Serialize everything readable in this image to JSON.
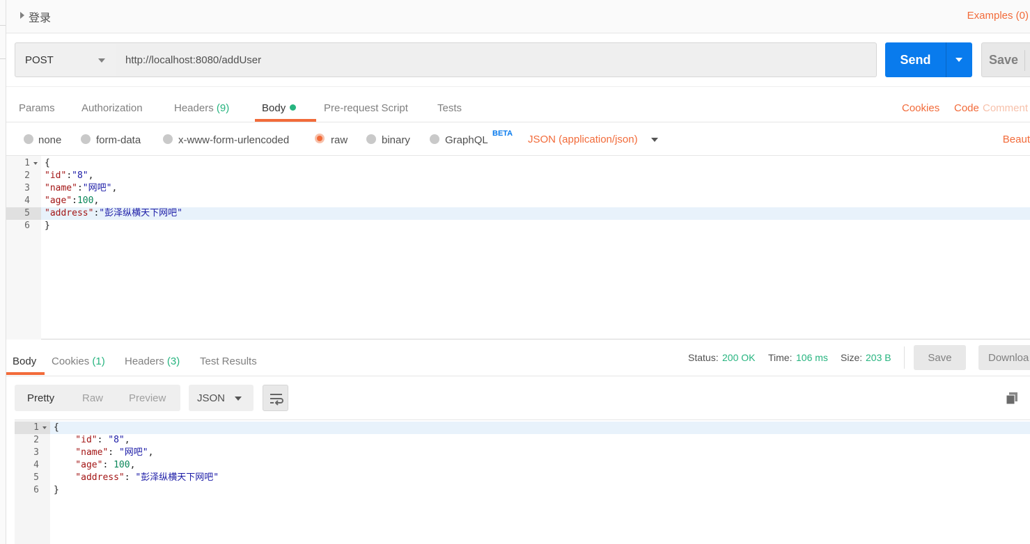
{
  "header": {
    "title": "登录",
    "examples_label": "Examples (0)"
  },
  "request": {
    "method": "POST",
    "url": "http://localhost:8080/addUser",
    "send_label": "Send",
    "save_label": "Save"
  },
  "request_tabs": {
    "params": "Params",
    "authorization": "Authorization",
    "headers": "Headers",
    "headers_count": "(9)",
    "body": "Body",
    "pre_request": "Pre-request Script",
    "tests": "Tests",
    "cookies": "Cookies",
    "code": "Code",
    "comments": "Comment"
  },
  "body_options": {
    "none": "none",
    "form_data": "form-data",
    "urlencoded": "x-www-form-urlencoded",
    "raw": "raw",
    "binary": "binary",
    "graphql": "GraphQL",
    "beta": "BETA",
    "content_type": "JSON (application/json)",
    "beautify": "Beaut",
    "selected": "raw"
  },
  "request_body": {
    "lines": [
      {
        "n": "1",
        "text": "{"
      },
      {
        "n": "2",
        "key": "\"id\"",
        "sep": ":",
        "val": "\"8\"",
        "end": ","
      },
      {
        "n": "3",
        "key": "\"name\"",
        "sep": ":",
        "val": "\"网吧\"",
        "end": ","
      },
      {
        "n": "4",
        "key": "\"age\"",
        "sep": ":",
        "val": "100",
        "end": ","
      },
      {
        "n": "5",
        "key": "\"address\"",
        "sep": ":",
        "val": "\"彭泽纵横天下网吧\"",
        "end": ""
      },
      {
        "n": "6",
        "text": "}"
      }
    ],
    "highlighted_line": 5
  },
  "response_tabs": {
    "body": "Body",
    "cookies": "Cookies",
    "cookies_count": "(1)",
    "headers": "Headers",
    "headers_count": "(3)",
    "test_results": "Test Results"
  },
  "response_status": {
    "status_label": "Status:",
    "status_value": "200 OK",
    "time_label": "Time:",
    "time_value": "106 ms",
    "size_label": "Size:",
    "size_value": "203 B",
    "save_label": "Save",
    "download_label": "Downloa"
  },
  "response_view": {
    "pretty": "Pretty",
    "raw": "Raw",
    "preview": "Preview",
    "format": "JSON"
  },
  "response_body": {
    "lines": [
      {
        "n": "1",
        "text": "{"
      },
      {
        "n": "2",
        "key": "    \"id\"",
        "sep": ": ",
        "val": "\"8\"",
        "end": ","
      },
      {
        "n": "3",
        "key": "    \"name\"",
        "sep": ": ",
        "val": "\"网吧\"",
        "end": ","
      },
      {
        "n": "4",
        "key": "    \"age\"",
        "sep": ": ",
        "val": "100",
        "end": ","
      },
      {
        "n": "5",
        "key": "    \"address\"",
        "sep": ": ",
        "val": "\"彭泽纵横天下网吧\"",
        "end": ""
      },
      {
        "n": "6",
        "text": "}"
      }
    ],
    "highlighted_line": 1
  },
  "colors": {
    "accent": "#f26b3a",
    "primary": "#097bed",
    "success": "#26b47f"
  }
}
